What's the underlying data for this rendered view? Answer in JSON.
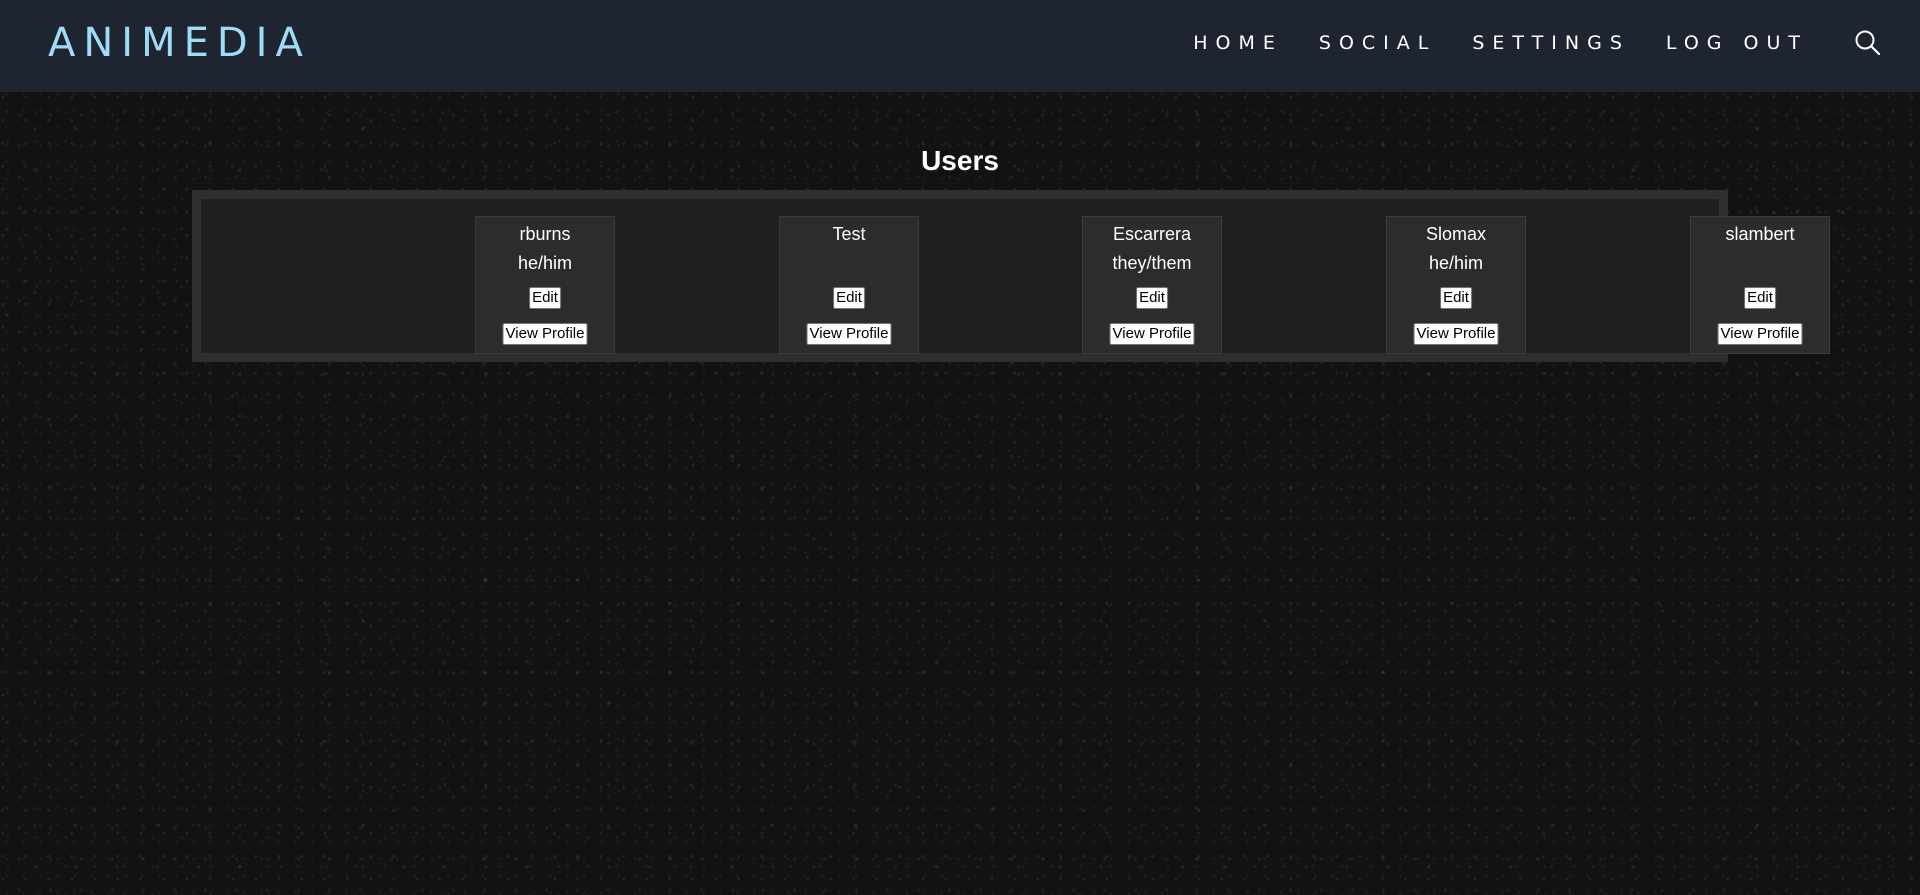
{
  "header": {
    "logo": "ANIMEDIA",
    "nav": [
      "HOME",
      "SOCIAL",
      "SETTINGS",
      "LOG OUT"
    ],
    "search_icon": "search-icon"
  },
  "main": {
    "title": "Users",
    "edit_label": "Edit",
    "view_label": "View Profile",
    "users": [
      {
        "name": "rburns",
        "pronouns": "he/him"
      },
      {
        "name": "Test",
        "pronouns": ""
      },
      {
        "name": "Escarrera",
        "pronouns": "they/them"
      },
      {
        "name": "Slomax",
        "pronouns": "he/him"
      },
      {
        "name": "slambert",
        "pronouns": ""
      }
    ]
  },
  "colors": {
    "navbar_bg": "#1f2431",
    "logo": "#9fdcf8",
    "page_bg": "#121212",
    "panel_bg": "#1f1f1f",
    "panel_border": "#2f2f2f",
    "card_bg": "#2c2c2c"
  }
}
